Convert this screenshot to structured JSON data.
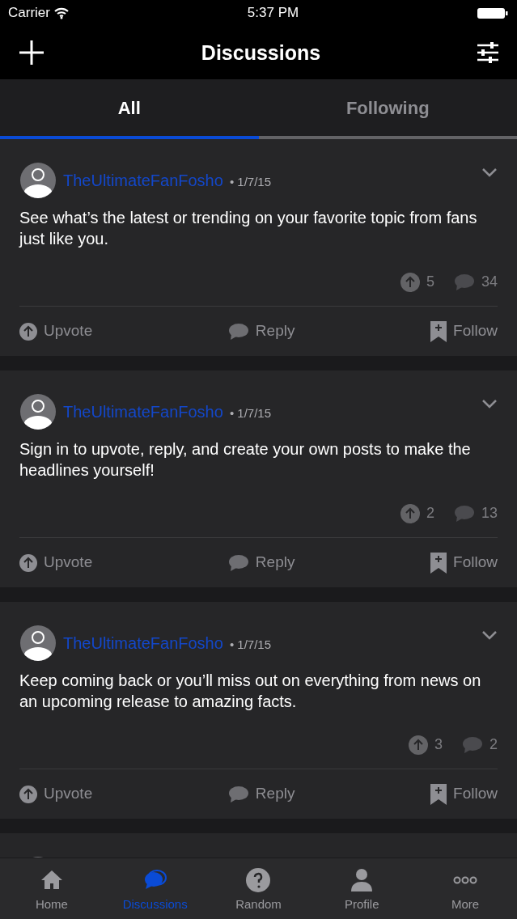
{
  "status_bar": {
    "carrier": "Carrier",
    "time": "5:37 PM"
  },
  "nav": {
    "title": "Discussions"
  },
  "tabs": [
    {
      "label": "All",
      "selected": true
    },
    {
      "label": "Following",
      "selected": false
    }
  ],
  "posts": [
    {
      "author": "TheUltimateFanFosho",
      "date": "• 1/7/15",
      "text": "See what’s the latest or trending on your favorite topic from fans just like you.",
      "upvotes": "5",
      "replies": "34",
      "actions": [
        "Upvote",
        "Reply",
        "Follow"
      ]
    },
    {
      "author": "TheUltimateFanFosho",
      "date": "• 1/7/15",
      "text": "Sign in to upvote, reply, and create your own posts to make the headlines yourself!",
      "upvotes": "2",
      "replies": "13",
      "actions": [
        "Upvote",
        "Reply",
        "Follow"
      ]
    },
    {
      "author": "TheUltimateFanFosho",
      "date": "• 1/7/15",
      "text": "Keep coming back or you’ll miss out on everything from news on an upcoming release to amazing facts.",
      "upvotes": "3",
      "replies": "2",
      "actions": [
        "Upvote",
        "Reply",
        "Follow"
      ]
    }
  ],
  "partial_post_below": true,
  "tab_bar": [
    {
      "kind": "home",
      "label": "Home",
      "selected": false
    },
    {
      "kind": "discussions",
      "label": "Discussions",
      "selected": true
    },
    {
      "kind": "random",
      "label": "Random",
      "selected": false
    },
    {
      "kind": "profile",
      "label": "Profile",
      "selected": false
    },
    {
      "kind": "more",
      "label": "More",
      "selected": false
    }
  ]
}
